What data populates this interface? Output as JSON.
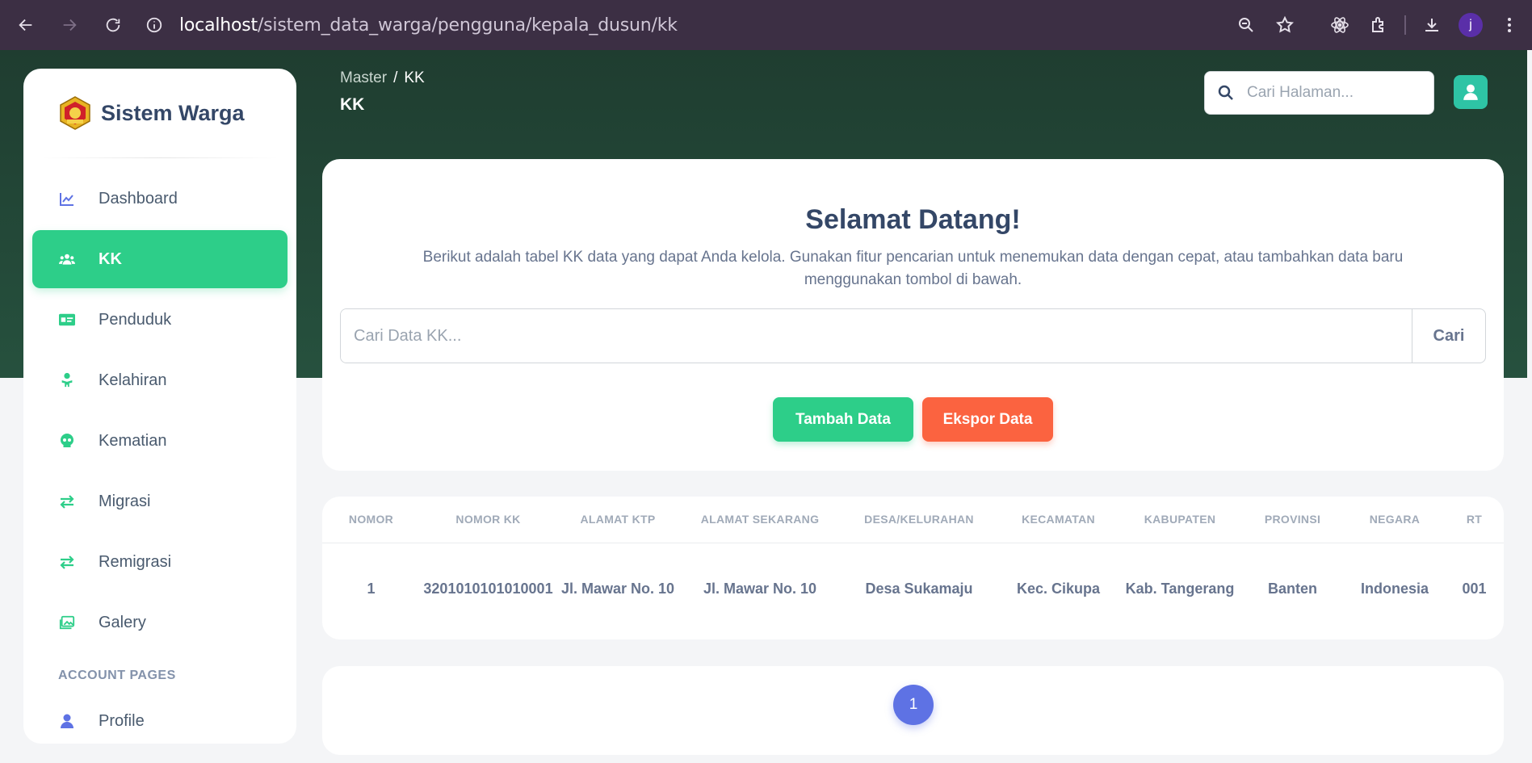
{
  "browser": {
    "url_host": "localhost",
    "url_path": "/sistem_data_warga/pengguna/kepala_dusun/kk",
    "profile_initial": "j"
  },
  "sidebar": {
    "brand": "Sistem Warga",
    "items": [
      {
        "label": "Dashboard",
        "icon": "chart-icon",
        "active": false
      },
      {
        "label": "KK",
        "icon": "users-icon",
        "active": true
      },
      {
        "label": "Penduduk",
        "icon": "id-card-icon",
        "active": false
      },
      {
        "label": "Kelahiran",
        "icon": "baby-icon",
        "active": false
      },
      {
        "label": "Kematian",
        "icon": "skull-icon",
        "active": false
      },
      {
        "label": "Migrasi",
        "icon": "exchange-icon",
        "active": false
      },
      {
        "label": "Remigrasi",
        "icon": "exchange-icon",
        "active": false
      },
      {
        "label": "Galery",
        "icon": "images-icon",
        "active": false
      }
    ],
    "section_title": "ACCOUNT PAGES",
    "account_items": [
      {
        "label": "Profile",
        "icon": "user-icon"
      }
    ]
  },
  "header": {
    "breadcrumb_parent": "Master",
    "breadcrumb_sep": "/",
    "breadcrumb_current": "KK",
    "title": "KK",
    "search_placeholder": "Cari Halaman..."
  },
  "welcome": {
    "heading": "Selamat Datang!",
    "description": "Berikut adalah tabel KK data yang dapat Anda kelola. Gunakan fitur pencarian untuk menemukan data dengan cepat, atau tambahkan data baru menggunakan tombol di bawah.",
    "search_placeholder": "Cari Data KK...",
    "search_button": "Cari",
    "add_button": "Tambah Data",
    "export_button": "Ekspor Data"
  },
  "table": {
    "columns": [
      "NOMOR",
      "NOMOR KK",
      "ALAMAT KTP",
      "ALAMAT SEKARANG",
      "DESA/KELURAHAN",
      "KECAMATAN",
      "KABUPATEN",
      "PROVINSI",
      "NEGARA",
      "RT"
    ],
    "rows": [
      [
        "1",
        "3201010101010001",
        "Jl. Mawar No. 10",
        "Jl. Mawar No. 10",
        "Desa Sukamaju",
        "Kec. Cikupa",
        "Kab. Tangerang",
        "Banten",
        "Indonesia",
        "001"
      ]
    ]
  },
  "pagination": {
    "current_page": "1"
  },
  "colors": {
    "accent_green": "#2dce89",
    "accent_orange": "#fb6340",
    "accent_blue": "#5e72e4",
    "header_bg": "#1f3d30"
  }
}
